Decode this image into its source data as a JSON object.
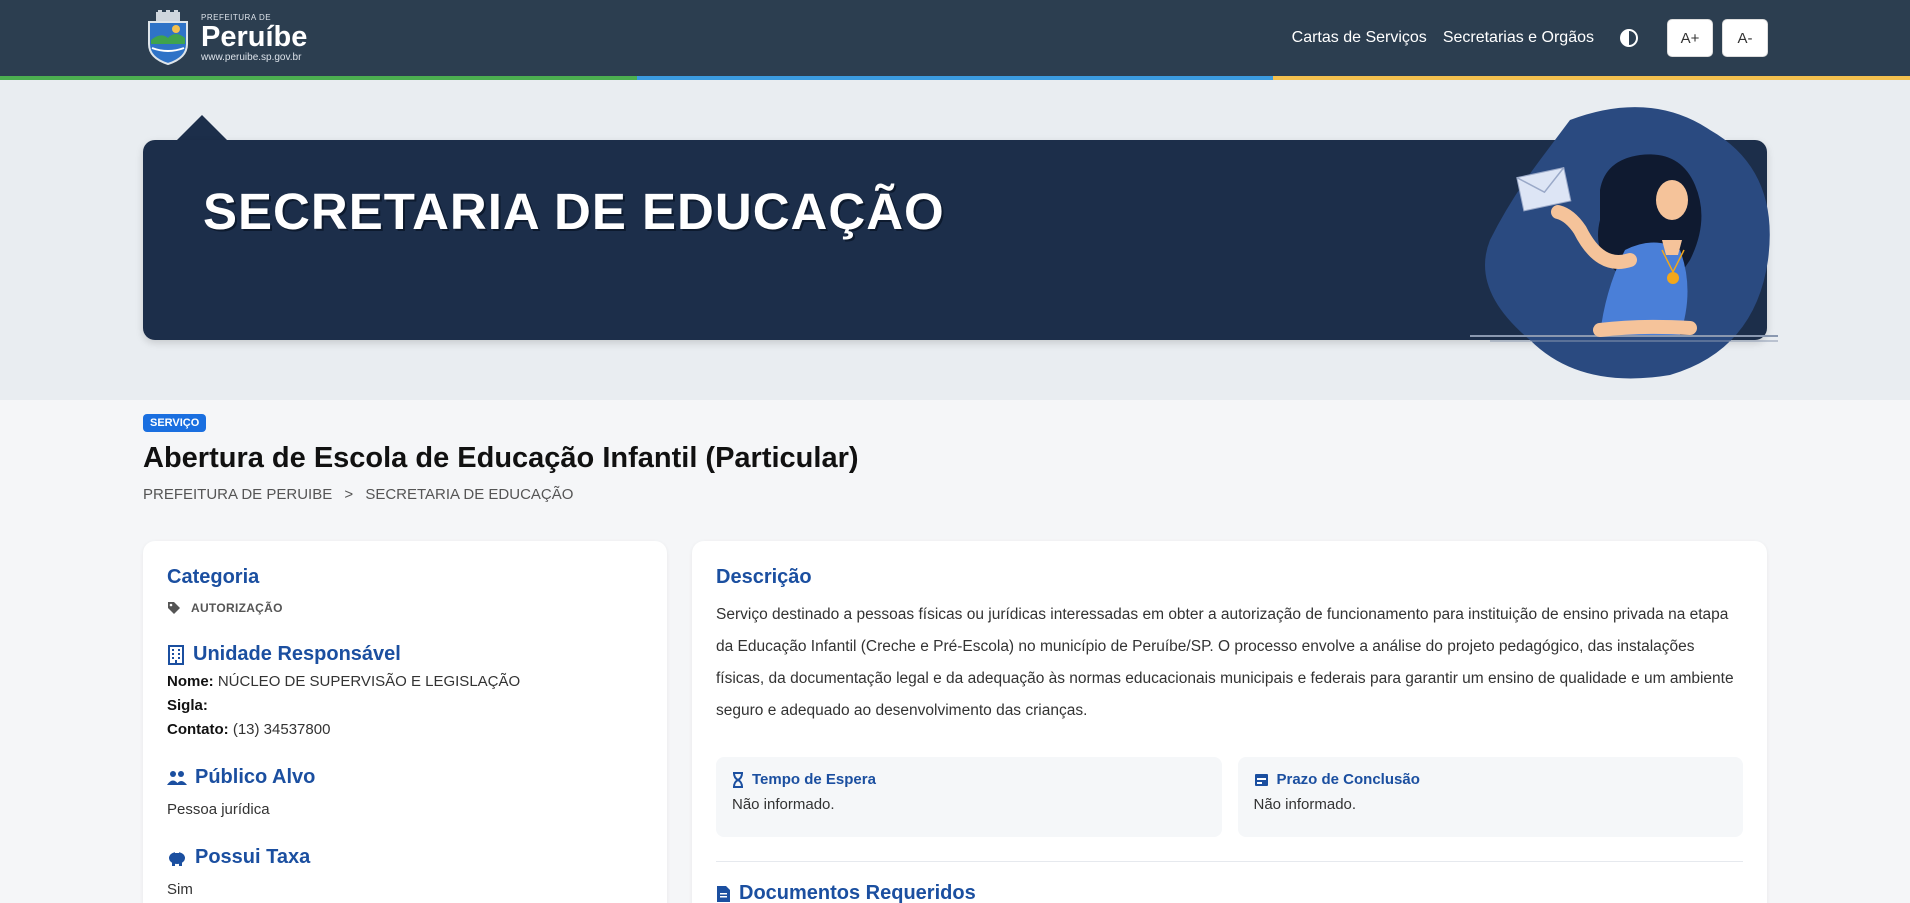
{
  "header": {
    "logo_small": "PREFEITURA DE",
    "logo_name": "Peruíbe",
    "logo_url": "www.peruibe.sp.gov.br",
    "nav": [
      {
        "label": "Cartas de Serviços"
      },
      {
        "label": "Secretarias e Orgãos"
      }
    ],
    "font_increase": "A+",
    "font_decrease": "A-",
    "stripe_colors": [
      "#4caf50",
      "#3b9be0",
      "#f4c04e"
    ]
  },
  "hero": {
    "title": "SECRETARIA DE EDUCAÇÃO"
  },
  "service": {
    "badge": "SERVIÇO",
    "title": "Abertura de Escola de Educação Infantil (Particular)",
    "breadcrumb": [
      "PREFEITURA DE PERUIBE",
      ">",
      "SECRETARIA DE EDUCAÇÃO"
    ]
  },
  "sidebar": {
    "category_heading": "Categoria",
    "category_value": "AUTORIZAÇÃO",
    "unit_heading": "Unidade Responsável",
    "unit_name_label": "Nome:",
    "unit_name_value": "NÚCLEO DE SUPERVISÃO E LEGISLAÇÃO",
    "unit_sigla_label": "Sigla:",
    "unit_contact_label": "Contato:",
    "unit_contact_value": "(13) 34537800",
    "audience_heading": "Público Alvo",
    "audience_value": "Pessoa jurídica",
    "fee_heading": "Possui Taxa",
    "fee_value": "Sim"
  },
  "content": {
    "desc_heading": "Descrição",
    "description": "Serviço destinado a pessoas físicas ou jurídicas interessadas em obter a autorização de funcionamento para instituição de ensino privada na etapa da Educação Infantil (Creche e Pré-Escola) no município de Peruíbe/SP. O processo envolve a análise do projeto pedagógico, das instalações físicas, da documentação legal e da adequação às normas educacionais municipais e federais para garantir um ensino de qualidade e um ambiente seguro e adequado ao desenvolvimento das crianças.",
    "wait_heading": "Tempo de Espera",
    "wait_value": "Não informado.",
    "deadline_heading": "Prazo de Conclusão",
    "deadline_value": "Não informado.",
    "docs_heading": "Documentos Requeridos"
  },
  "colors": {
    "header_bg": "#2c3e50",
    "banner_bg": "#1c2e4a",
    "accent_blue": "#1b4fa0",
    "badge_blue": "#1a6fe0"
  }
}
